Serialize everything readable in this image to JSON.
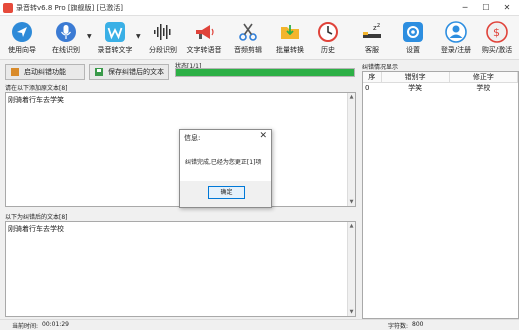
{
  "window": {
    "title": "录音转v6.8 Pro  [旗舰版] [已激活]",
    "minimize": "─",
    "maximize": "☐",
    "close": "✕"
  },
  "toolbar": {
    "items": [
      {
        "label": "使用向导",
        "icon": "navigation-arrow-icon"
      },
      {
        "label": "在线识别",
        "icon": "microphone-icon"
      },
      {
        "label": "录音转文字",
        "icon": "w-logo-icon"
      },
      {
        "label": "分段识别",
        "icon": "waveform-icon"
      },
      {
        "label": "文字转语音",
        "icon": "megaphone-icon"
      },
      {
        "label": "音频剪辑",
        "icon": "scissors-icon"
      },
      {
        "label": "批量转换",
        "icon": "folder-icon"
      },
      {
        "label": "历史",
        "icon": "history-icon"
      },
      {
        "label": "客服",
        "icon": "sleep-bed-icon"
      },
      {
        "label": "设置",
        "icon": "settings-icon"
      },
      {
        "label": "登录/注册",
        "icon": "user-icon"
      },
      {
        "label": "购买/激活",
        "icon": "coin-icon"
      }
    ],
    "dropdown_arrow": "▼"
  },
  "actions": {
    "start_correction": "启动纠错功能",
    "save_corrected": "保存纠错后的文本"
  },
  "status": {
    "label": "状态[1/1]",
    "progress": 1.0,
    "progress_color": "#2db046"
  },
  "input_section": {
    "label": "请在以下添加原文本[8]",
    "text": "刚骑着行车去学笑"
  },
  "output_section": {
    "label": "以下为纠错后的文本[8]",
    "text": "刚骑着行车去学校"
  },
  "panel": {
    "title": "纠错情况显示",
    "columns": [
      "序",
      "错别字",
      "修正字"
    ],
    "rows": [
      [
        "0",
        "学笑",
        "学校"
      ]
    ]
  },
  "statusbar": {
    "time_label": "当前时间:",
    "time_value": "00:01:29",
    "chars_label": "字符数:",
    "chars_value": "800"
  },
  "dialog": {
    "title": "信息:",
    "close": "✕",
    "message": "纠错完成,已经为您更正[1]项",
    "ok_label": "确定"
  }
}
